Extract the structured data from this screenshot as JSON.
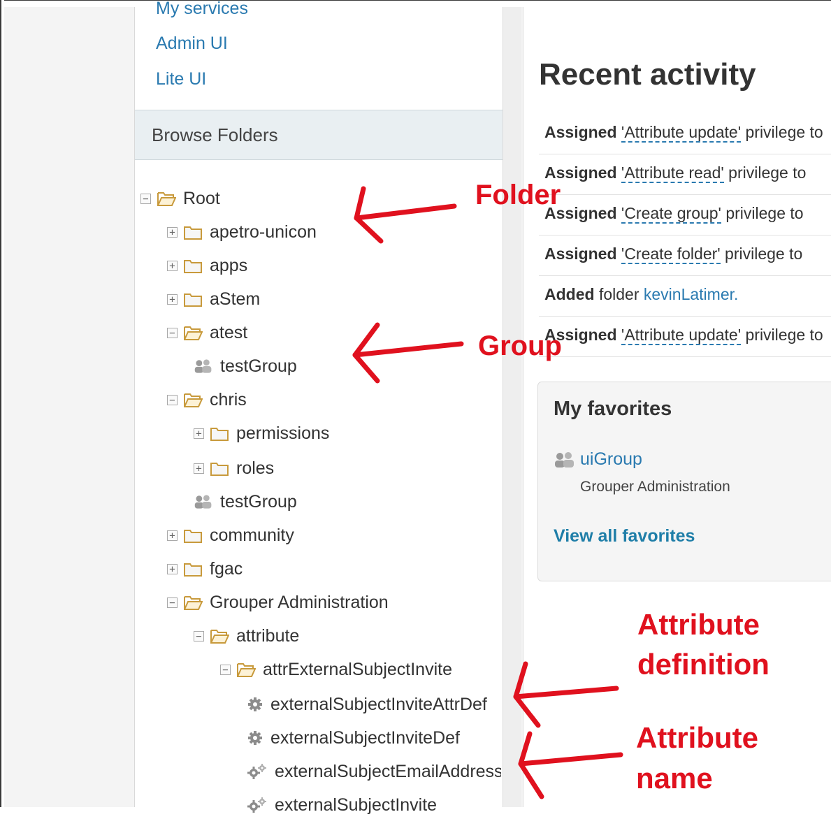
{
  "sidebar": {
    "links": [
      "My services",
      "Admin UI",
      "Lite UI"
    ],
    "browse_header": "Browse Folders",
    "tree": [
      {
        "label": "Root",
        "toggle": "−",
        "type": "folder-open"
      },
      {
        "label": "apetro-unicon",
        "toggle": "+",
        "type": "folder"
      },
      {
        "label": "apps",
        "toggle": "+",
        "type": "folder"
      },
      {
        "label": "aStem",
        "toggle": "+",
        "type": "folder"
      },
      {
        "label": "atest",
        "toggle": "−",
        "type": "folder-open"
      },
      {
        "label": "testGroup",
        "toggle": "",
        "type": "group"
      },
      {
        "label": "chris",
        "toggle": "−",
        "type": "folder-open"
      },
      {
        "label": "permissions",
        "toggle": "+",
        "type": "folder"
      },
      {
        "label": "roles",
        "toggle": "+",
        "type": "folder"
      },
      {
        "label": "testGroup",
        "toggle": "",
        "type": "group"
      },
      {
        "label": "community",
        "toggle": "+",
        "type": "folder"
      },
      {
        "label": "fgac",
        "toggle": "+",
        "type": "folder"
      },
      {
        "label": "Grouper Administration",
        "toggle": "−",
        "type": "folder-open"
      },
      {
        "label": "attribute",
        "toggle": "−",
        "type": "folder-open"
      },
      {
        "label": "attrExternalSubjectInvite",
        "toggle": "−",
        "type": "folder-open"
      },
      {
        "label": "externalSubjectInviteAttrDef",
        "toggle": "",
        "type": "attr-def"
      },
      {
        "label": "externalSubjectInviteDef",
        "toggle": "",
        "type": "attr-def"
      },
      {
        "label": "externalSubjectEmailAddress",
        "toggle": "",
        "type": "attr-name"
      },
      {
        "label": "externalSubjectInvite",
        "toggle": "",
        "type": "attr-name"
      }
    ]
  },
  "main": {
    "recent_title": "Recent activity",
    "activity": [
      {
        "verb": "Assigned",
        "quoted": "'Attribute update'",
        "rest": " privilege to"
      },
      {
        "verb": "Assigned",
        "quoted": "'Attribute read'",
        "rest": " privilege to"
      },
      {
        "verb": "Assigned",
        "quoted": "'Create group'",
        "rest": " privilege to"
      },
      {
        "verb": "Assigned",
        "quoted": "'Create folder'",
        "rest": " privilege to"
      },
      {
        "verb": "Added",
        "text": " folder ",
        "link": "kevinLatimer."
      },
      {
        "verb": "Assigned",
        "quoted": "'Attribute update'",
        "rest": " privilege to"
      }
    ],
    "favorites": {
      "title": "My favorites",
      "item_label": "uiGroup",
      "item_path": "Grouper Administration",
      "view_all": "View all favorites"
    }
  },
  "annotations": {
    "folder": "Folder",
    "group": "Group",
    "attr_def_line1": "Attribute",
    "attr_def_line2": "definition",
    "attr_name_line1": "Attribute",
    "attr_name_line2": "name",
    "color": "#e0111e"
  }
}
